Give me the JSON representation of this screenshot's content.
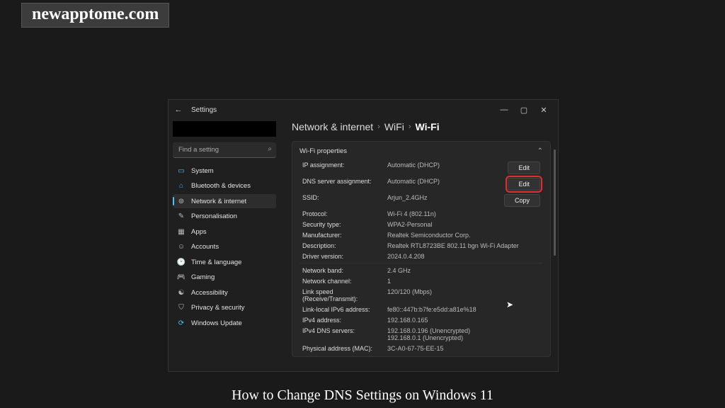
{
  "watermark": "newapptome.com",
  "caption": "How to Change DNS Settings on Windows 11",
  "window": {
    "title": "Settings",
    "search_placeholder": "Find a setting"
  },
  "sidebar": {
    "items": [
      {
        "label": "System"
      },
      {
        "label": "Bluetooth & devices"
      },
      {
        "label": "Network & internet"
      },
      {
        "label": "Personalisation"
      },
      {
        "label": "Apps"
      },
      {
        "label": "Accounts"
      },
      {
        "label": "Time & language"
      },
      {
        "label": "Gaming"
      },
      {
        "label": "Accessibility"
      },
      {
        "label": "Privacy & security"
      },
      {
        "label": "Windows Update"
      }
    ]
  },
  "breadcrumb": {
    "root": "Network & internet",
    "mid": "WiFi",
    "leaf": "Wi-Fi"
  },
  "card_title": "Wi-Fi properties",
  "buttons": {
    "edit": "Edit",
    "copy": "Copy"
  },
  "props": {
    "ip_assign_label": "IP assignment:",
    "ip_assign_value": "Automatic (DHCP)",
    "dns_assign_label": "DNS server assignment:",
    "dns_assign_value": "Automatic (DHCP)",
    "ssid_label": "SSID:",
    "ssid_value": "Arjun_2.4GHz",
    "proto_label": "Protocol:",
    "proto_value": "Wi-Fi 4 (802.11n)",
    "sec_label": "Security type:",
    "sec_value": "WPA2-Personal",
    "mfr_label": "Manufacturer:",
    "mfr_value": "Realtek Semiconductor Corp.",
    "desc_label": "Description:",
    "desc_value": "Realtek RTL8723BE 802.11 bgn Wi-Fi Adapter",
    "drv_label": "Driver version:",
    "drv_value": "2024.0.4.208",
    "band_label": "Network band:",
    "band_value": "2.4 GHz",
    "chan_label": "Network channel:",
    "chan_value": "1",
    "link_label": "Link speed (Receive/Transmit):",
    "link_value": "120/120 (Mbps)",
    "llv6_label": "Link-local IPv6 address:",
    "llv6_value": "fe80::447b:b7fe:e5dd:a81e%18",
    "ipv4_label": "IPv4 address:",
    "ipv4_value": "192.168.0.165",
    "dns4_label": "IPv4 DNS servers:",
    "dns4_value": "192.168.0.196 (Unencrypted)\n192.168.0.1 (Unencrypted)",
    "mac_label": "Physical address (MAC):",
    "mac_value": "3C-A0-67-75-EE-15"
  }
}
